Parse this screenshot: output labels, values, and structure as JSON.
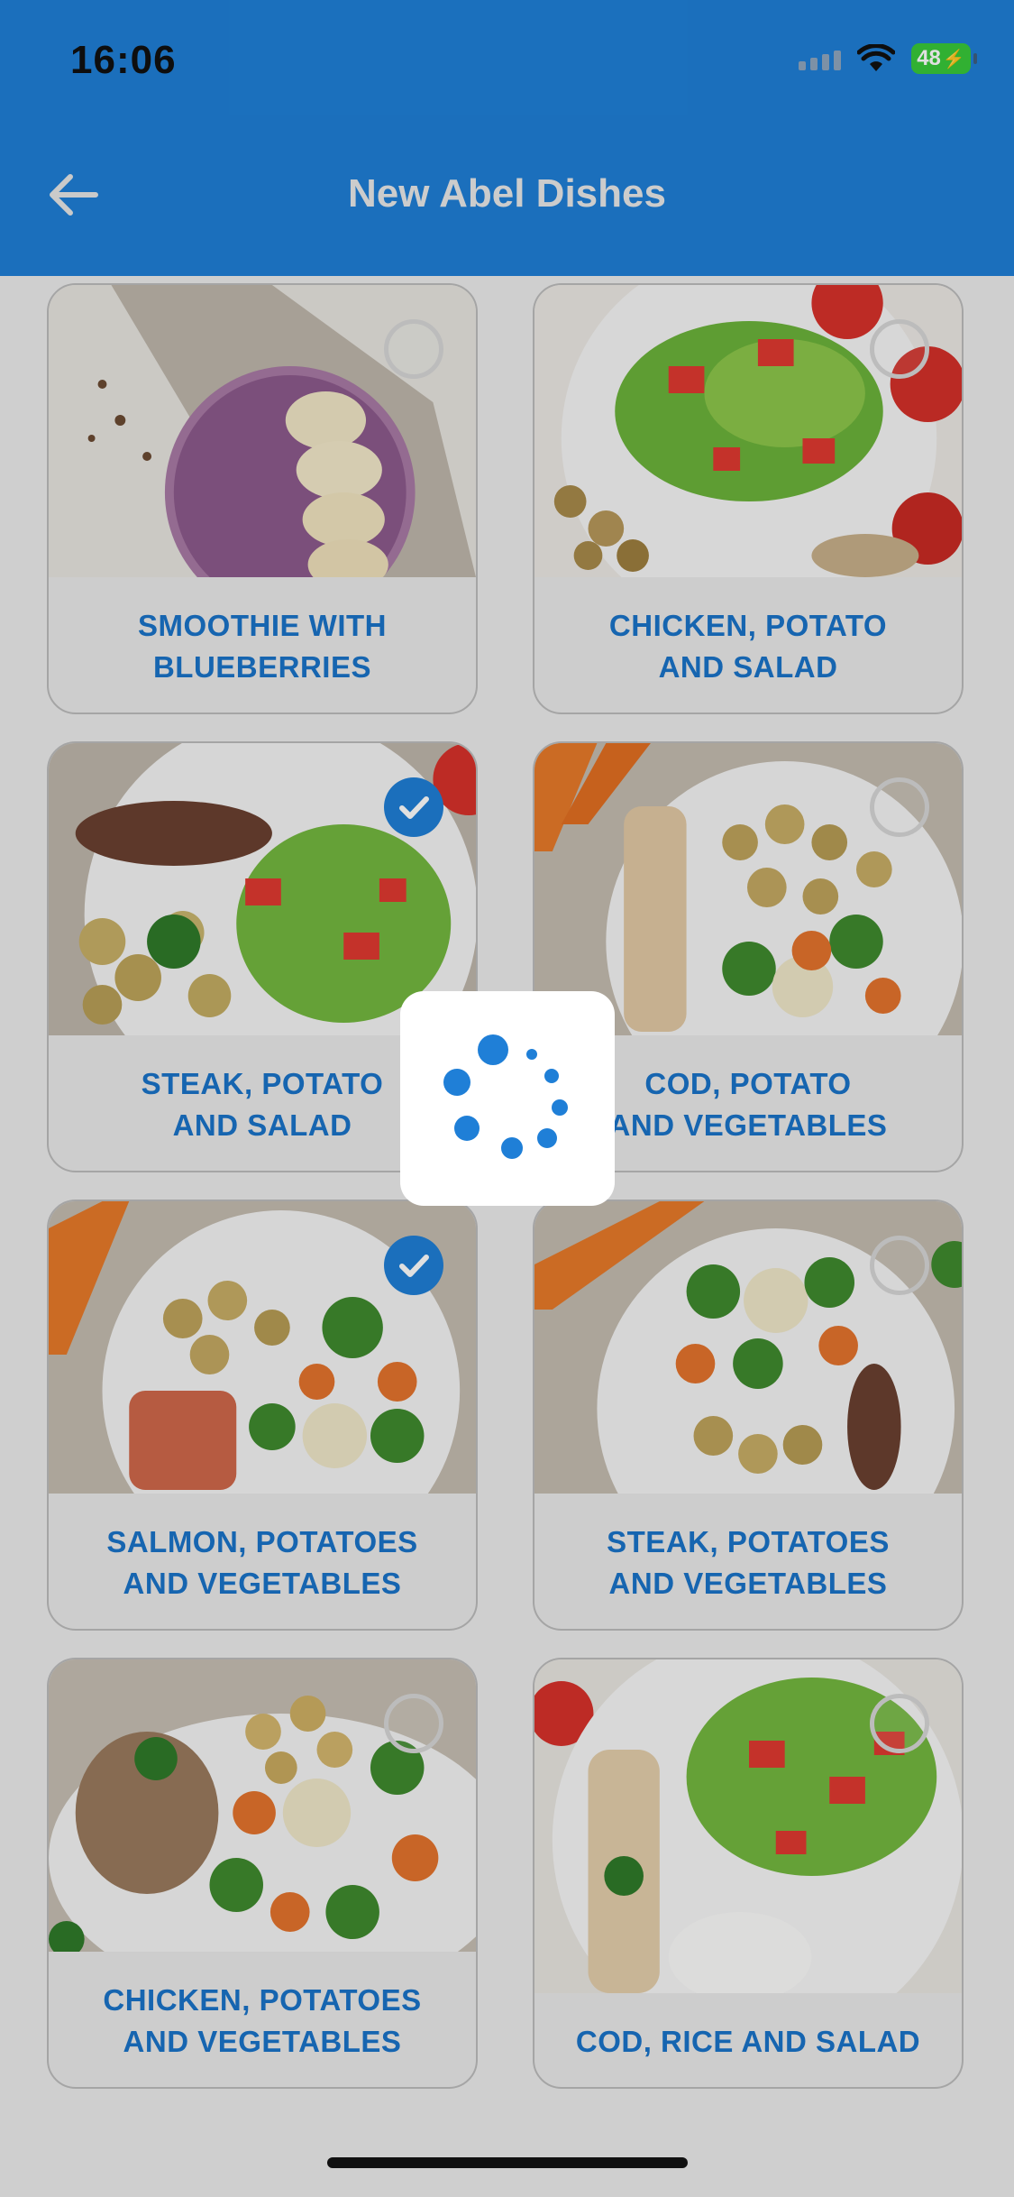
{
  "status_bar": {
    "time": "16:06",
    "battery": "48"
  },
  "header": {
    "title": "New Abel Dishes",
    "back_icon": "arrow-left-icon"
  },
  "dishes": [
    {
      "name": "SMOOTHIE WITH BLUEBERRIES",
      "line1": "SMOOTHIE WITH",
      "line2": "BLUEBERRIES",
      "selected": false
    },
    {
      "name": "CHICKEN, POTATO AND SALAD",
      "line1": "CHICKEN, POTATO",
      "line2": "AND SALAD",
      "selected": false
    },
    {
      "name": "STEAK, POTATO AND SALAD",
      "line1": "STEAK, POTATO",
      "line2": "AND SALAD",
      "selected": true
    },
    {
      "name": "COD, POTATO AND VEGETABLES",
      "line1": "COD, POTATO",
      "line2": "AND VEGETABLES",
      "selected": false
    },
    {
      "name": "SALMON, POTATOES AND VEGETABLES",
      "line1": "SALMON, POTATOES",
      "line2": "AND VEGETABLES",
      "selected": true
    },
    {
      "name": "STEAK, POTATOES AND VEGETABLES",
      "line1": "STEAK, POTATOES",
      "line2": "AND VEGETABLES",
      "selected": false
    },
    {
      "name": "CHICKEN, POTATOES AND VEGETABLES",
      "line1": "CHICKEN, POTATOES",
      "line2": "AND VEGETABLES",
      "selected": false
    },
    {
      "name": "COD, RICE AND SALAD",
      "line1": "COD, RICE AND SALAD",
      "line2": "",
      "selected": false
    }
  ],
  "colors": {
    "accent": "#1f7fd7",
    "label": "#1a73c9"
  }
}
